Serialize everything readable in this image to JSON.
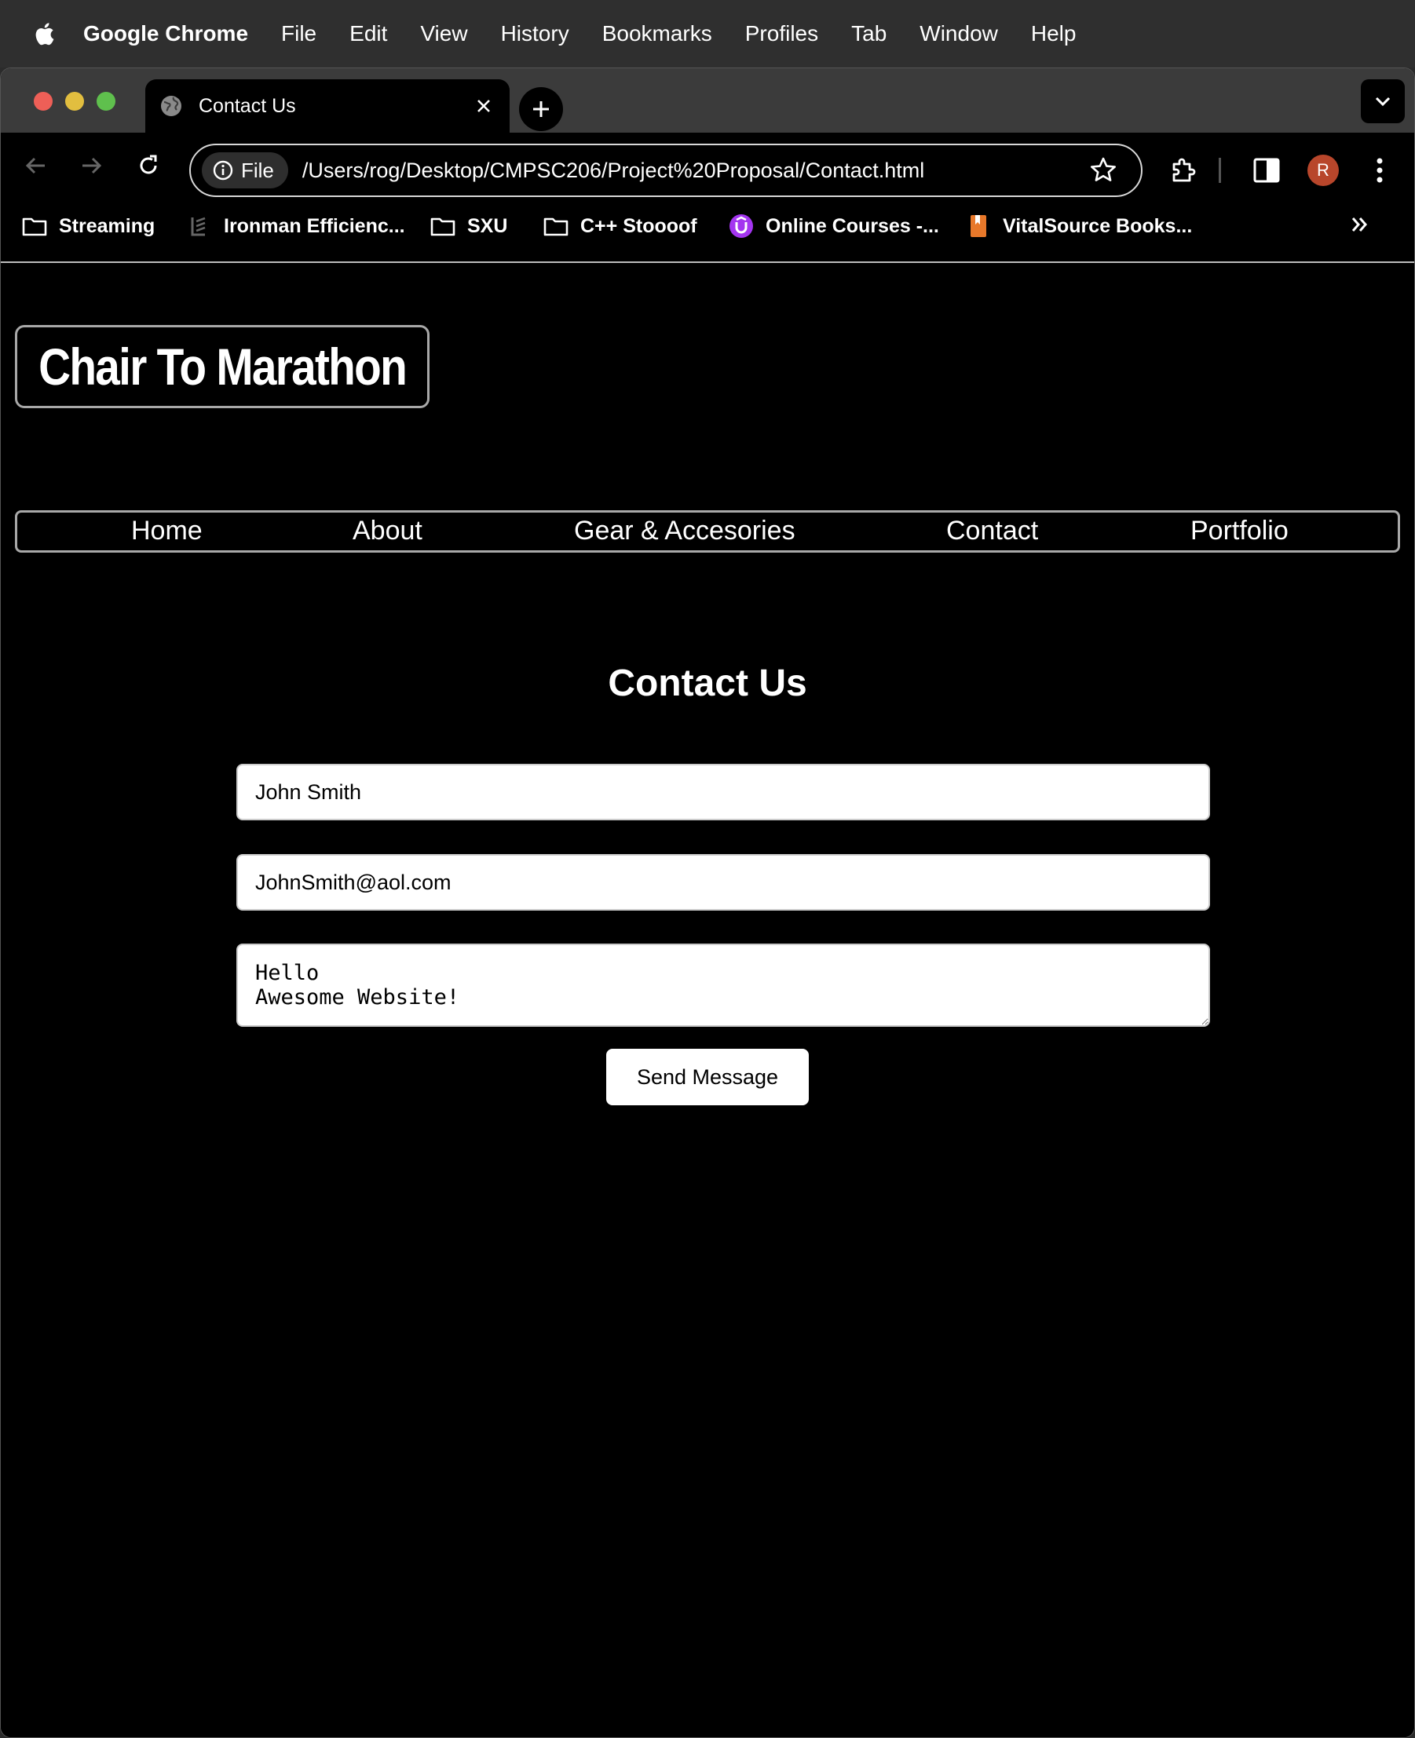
{
  "menubar": {
    "app_name": "Google Chrome",
    "items": [
      "File",
      "Edit",
      "View",
      "History",
      "Bookmarks",
      "Profiles",
      "Tab",
      "Window",
      "Help"
    ]
  },
  "browser": {
    "tab_title": "Contact Us",
    "chip_label": "File",
    "url": "/Users/rog/Desktop/CMPSC206/Project%20Proposal/Contact.html",
    "avatar_initial": "R",
    "bookmarks": [
      {
        "label": "Streaming",
        "icon": "folder-icon"
      },
      {
        "label": "Ironman Efficienc...",
        "icon": "site-icon"
      },
      {
        "label": "SXU",
        "icon": "folder-icon"
      },
      {
        "label": "C++ Stoooof",
        "icon": "folder-icon"
      },
      {
        "label": "Online Courses -...",
        "icon": "udemy-icon"
      },
      {
        "label": "VitalSource Books...",
        "icon": "book-icon"
      }
    ]
  },
  "page": {
    "logo": "Chair To Marathon",
    "nav": [
      "Home",
      "About",
      "Gear & Accesories",
      "Contact",
      "Portfolio"
    ],
    "heading": "Contact Us",
    "name_value": "John Smith",
    "email_value": "JohnSmith@aol.com",
    "message_value": "Hello\nAwesome Website!",
    "send_label": "Send Message"
  },
  "colors": {
    "page_bg": "#000000",
    "chrome_frame": "#3b3b3b",
    "avatar": "#b8462b",
    "udemy": "#a435f0",
    "vitalsource": "#e8782a"
  }
}
